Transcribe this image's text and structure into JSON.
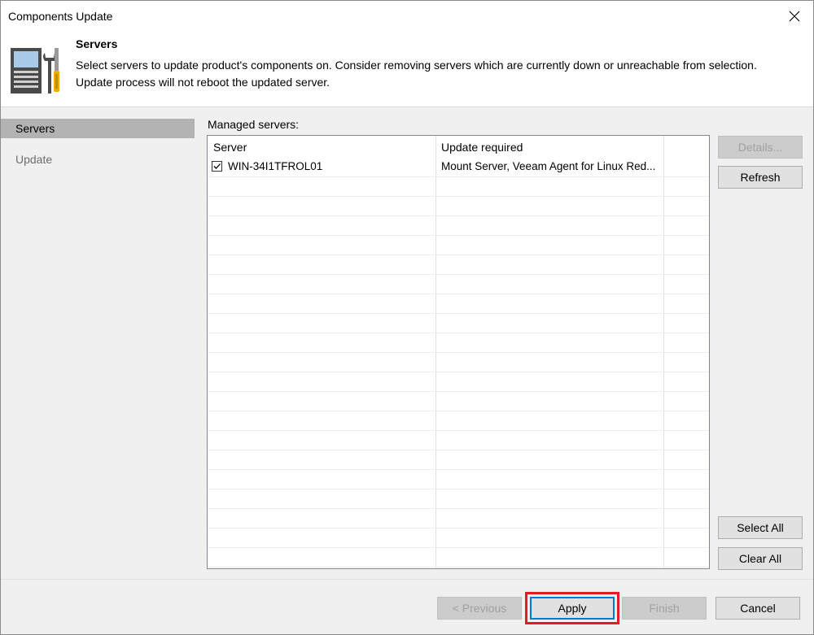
{
  "window": {
    "title": "Components Update"
  },
  "header": {
    "title": "Servers",
    "description_line1": "Select servers to update product's components on. Consider removing servers which are currently down or unreachable from selection.",
    "description_line2": "Update process will not reboot the updated server."
  },
  "sidebar": {
    "items": [
      {
        "label": "Servers",
        "active": true
      },
      {
        "label": "Update",
        "active": false
      }
    ]
  },
  "main": {
    "managed_label": "Managed servers:",
    "columns": [
      "Server",
      "Update required"
    ],
    "rows": [
      {
        "checked": true,
        "server": "WIN-34I1TFROL01",
        "update_required": "Mount Server, Veeam Agent for Linux Red..."
      }
    ]
  },
  "side_buttons": {
    "details": "Details...",
    "refresh": "Refresh",
    "select_all": "Select All",
    "clear_all": "Clear All"
  },
  "footer": {
    "previous": "< Previous",
    "apply": "Apply",
    "finish": "Finish",
    "cancel": "Cancel"
  },
  "colors": {
    "highlight": "#e31b23",
    "accent": "#0078d7"
  }
}
